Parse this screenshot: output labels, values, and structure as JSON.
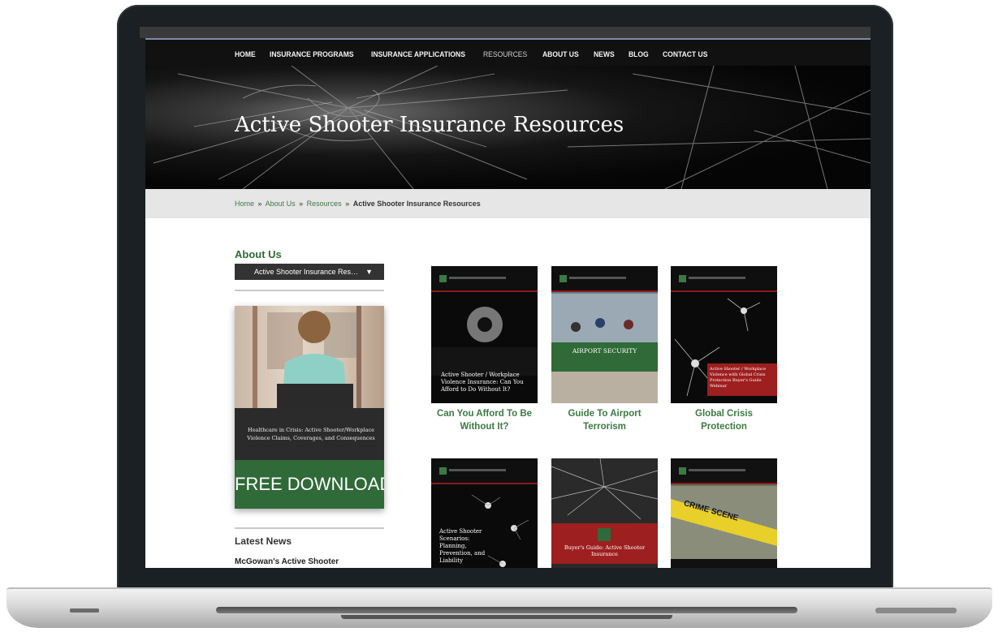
{
  "nav": {
    "items": [
      {
        "label": "HOME",
        "active": false
      },
      {
        "label": "INSURANCE PROGRAMS",
        "active": false
      },
      {
        "label": "INSURANCE APPLICATIONS",
        "active": false
      },
      {
        "label": "RESOURCES",
        "active": true
      },
      {
        "label": "ABOUT US",
        "active": false
      },
      {
        "label": "NEWS",
        "active": false
      },
      {
        "label": "BLOG",
        "active": false
      },
      {
        "label": "CONTACT US",
        "active": false
      }
    ]
  },
  "hero": {
    "title": "Active Shooter Insurance Resources"
  },
  "breadcrumb": {
    "items": [
      "Home",
      "About Us",
      "Resources"
    ],
    "separator": "»",
    "current": "Active Shooter Insurance Resources"
  },
  "sidebar": {
    "title": "About Us",
    "select_value": "Active Shooter Insurance Res…",
    "promo": {
      "text": "Healthcare in Crisis: Active Shooter/Workplace Violence Claims, Coverages, and Consequences",
      "cta": "FREE DOWNLOAD"
    },
    "latest_news_title": "Latest News",
    "latest_news_item": "McGowan's Active Shooter"
  },
  "resources": [
    {
      "label_line1": "Can You Afford To Be",
      "label_line2": "Without It?",
      "cover_text": "Active Shooter / Workplace Violence Insurance: Can You Afford to Do Without It?"
    },
    {
      "label_line1": "Guide To Airport",
      "label_line2": "Terrorism",
      "cover_text": "AIRPORT SECURITY"
    },
    {
      "label_line1": "Global Crisis",
      "label_line2": "Protection",
      "cover_text": "Active Shooter / Workplace Violence with Global Crisis Protection Buyer's Guide Webinar"
    },
    {
      "label_line1": "",
      "label_line2": "",
      "cover_text": "Active Shooter Scenarios: Planning, Prevention, and Liability"
    },
    {
      "label_line1": "",
      "label_line2": "",
      "cover_text": "Buyer's Guide: Active Shooter Insurance"
    },
    {
      "label_line1": "",
      "label_line2": "",
      "cover_text": "CRIME SCENE"
    }
  ],
  "colors": {
    "accent_green": "#3b7a43",
    "nav_bg": "#111111",
    "cover_red": "#8b1a1a",
    "laptop_frame": "#1a2023"
  }
}
